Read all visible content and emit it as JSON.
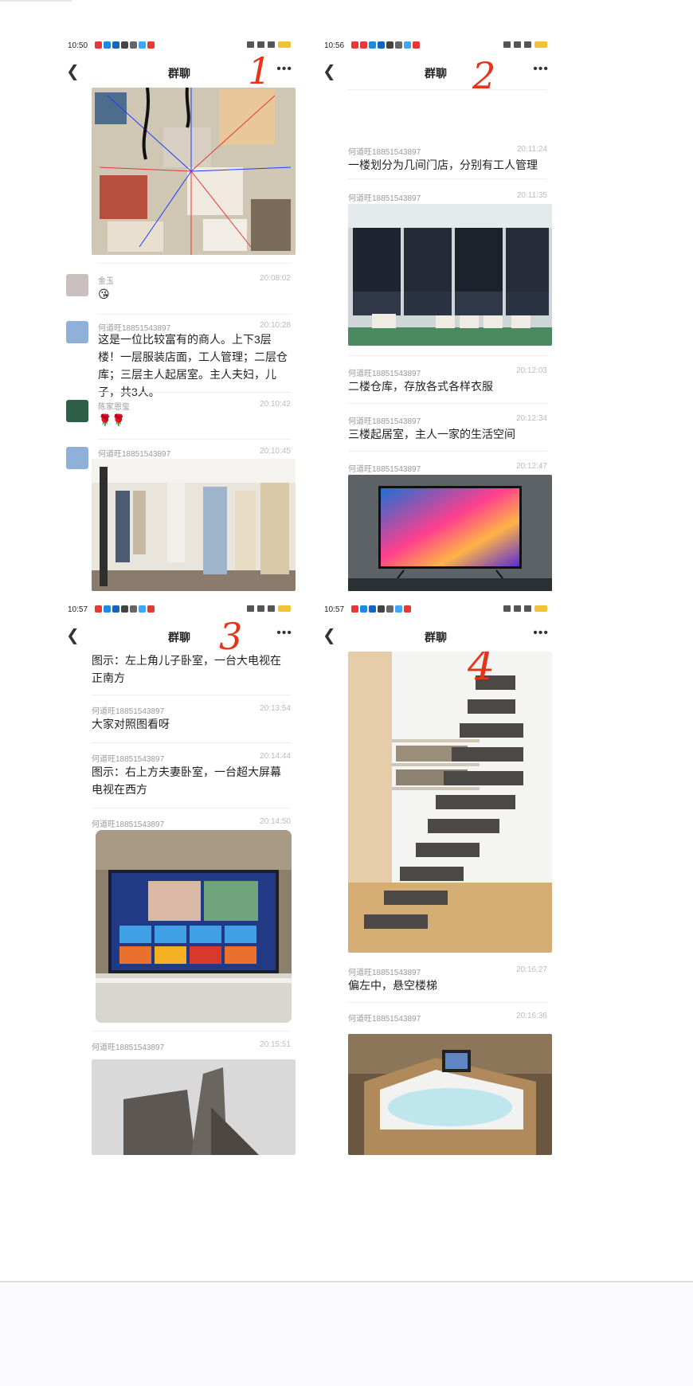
{
  "panels": [
    {
      "status_time": "10:50",
      "nav_title": "群聊",
      "marker": "1",
      "messages": [
        {
          "sender": "金玉",
          "time": "20:08:02",
          "text": "😘"
        },
        {
          "sender": "何道旺18851543897",
          "time": "20:10:28",
          "text": "这是一位比较富有的商人。上下3层楼！一层服装店面，工人管理；二层仓库；三层主人起居室。主人夫妇，儿子，共3人。"
        },
        {
          "sender": "陈家恩玺",
          "time": "20:10:42",
          "text": "🌹🌹"
        },
        {
          "sender": "何道旺18851543897",
          "time": "20:10:45",
          "text": ""
        }
      ]
    },
    {
      "status_time": "10:56",
      "nav_title": "群聊",
      "marker": "2",
      "messages": [
        {
          "sender": "何道旺18851543897",
          "time": "20:11:24",
          "text": "一楼划分为几间门店，分别有工人管理"
        },
        {
          "sender": "何道旺18851543897",
          "time": "20:11:35",
          "text": ""
        },
        {
          "sender": "何道旺18851543897",
          "time": "20:12:03",
          "text": "二楼仓库，存放各式各样衣服"
        },
        {
          "sender": "何道旺18851543897",
          "time": "20:12:34",
          "text": "三楼起居室，主人一家的生活空间"
        },
        {
          "sender": "何道旺18851543897",
          "time": "20:12:47",
          "text": ""
        }
      ]
    },
    {
      "status_time": "10:57",
      "nav_title": "群聊",
      "marker": "3",
      "messages": [
        {
          "sender": "",
          "time": "",
          "text": "图示：左上角儿子卧室，一台大电视在正南方"
        },
        {
          "sender": "何道旺18851543897",
          "time": "20:13:54",
          "text": "大家对照图看呀"
        },
        {
          "sender": "何道旺18851543897",
          "time": "20:14:44",
          "text": "图示：右上方夫妻卧室，一台超大屏幕电视在西方"
        },
        {
          "sender": "何道旺18851543897",
          "time": "20:14:50",
          "text": ""
        },
        {
          "sender": "何道旺18851543897",
          "time": "20:15:51",
          "text": ""
        }
      ]
    },
    {
      "status_time": "10:57",
      "nav_title": "群聊",
      "marker": "4",
      "messages": [
        {
          "sender": "何道旺18851543897",
          "time": "20:16:27",
          "text": "偏左中，悬空楼梯"
        },
        {
          "sender": "何道旺18851543897",
          "time": "20:16:36",
          "text": ""
        }
      ]
    }
  ]
}
